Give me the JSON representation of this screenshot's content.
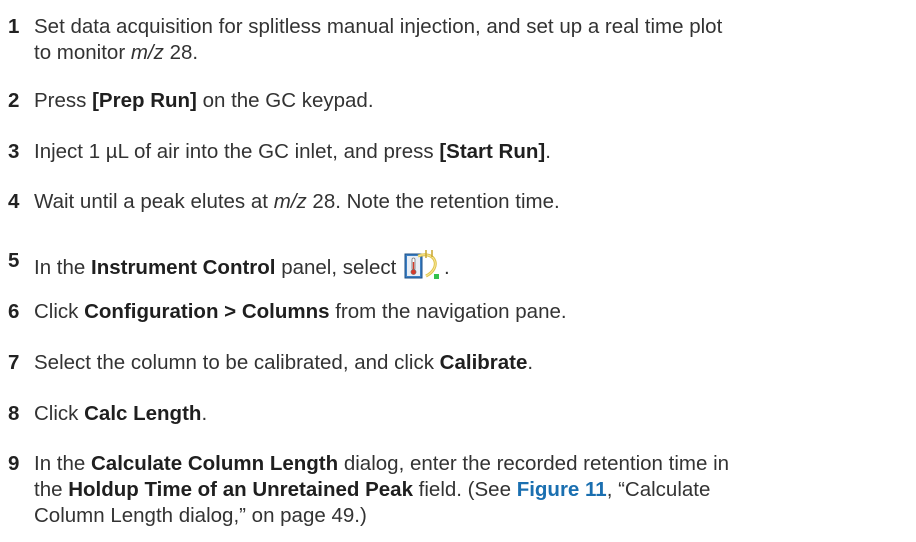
{
  "steps": [
    {
      "num": "1",
      "a": "Set data acquisition for splitless manual injection, and set up a real time plot",
      "b": "to monitor ",
      "c": "m/z",
      "d": " 28."
    },
    {
      "num": "2",
      "a": "Press ",
      "b": "[Prep Run]",
      "c": " on the GC keypad."
    },
    {
      "num": "3",
      "a": "Inject 1 µL of air into the GC inlet, and press ",
      "b": "[Start Run]",
      "c": "."
    },
    {
      "num": "4",
      "a": "Wait until a peak elutes at ",
      "b": "m/z",
      "c": " 28. Note the retention time."
    },
    {
      "num": "5",
      "a": "In the ",
      "b": "Instrument Control",
      "c": " panel, select ",
      "d": "."
    },
    {
      "num": "6",
      "a": "Click ",
      "b": "Configuration > Columns",
      "c": " from the navigation pane."
    },
    {
      "num": "7",
      "a": "Select the column to be calibrated, and click ",
      "b": "Calibrate",
      "c": "."
    },
    {
      "num": "8",
      "a": "Click ",
      "b": "Calc Length",
      "c": "."
    },
    {
      "num": "9",
      "a": "In the ",
      "b": "Calculate Column Length",
      "c": " dialog, enter the recorded retention time in",
      "d": "the ",
      "e": "Holdup Time of an Unretained Peak",
      "f": " field. (See ",
      "g": "Figure 11",
      "h": ", “Calculate",
      "i": "Column Length dialog,” on page 49.)"
    }
  ],
  "icons": {
    "step5": "gc-column-configuration-icon"
  }
}
